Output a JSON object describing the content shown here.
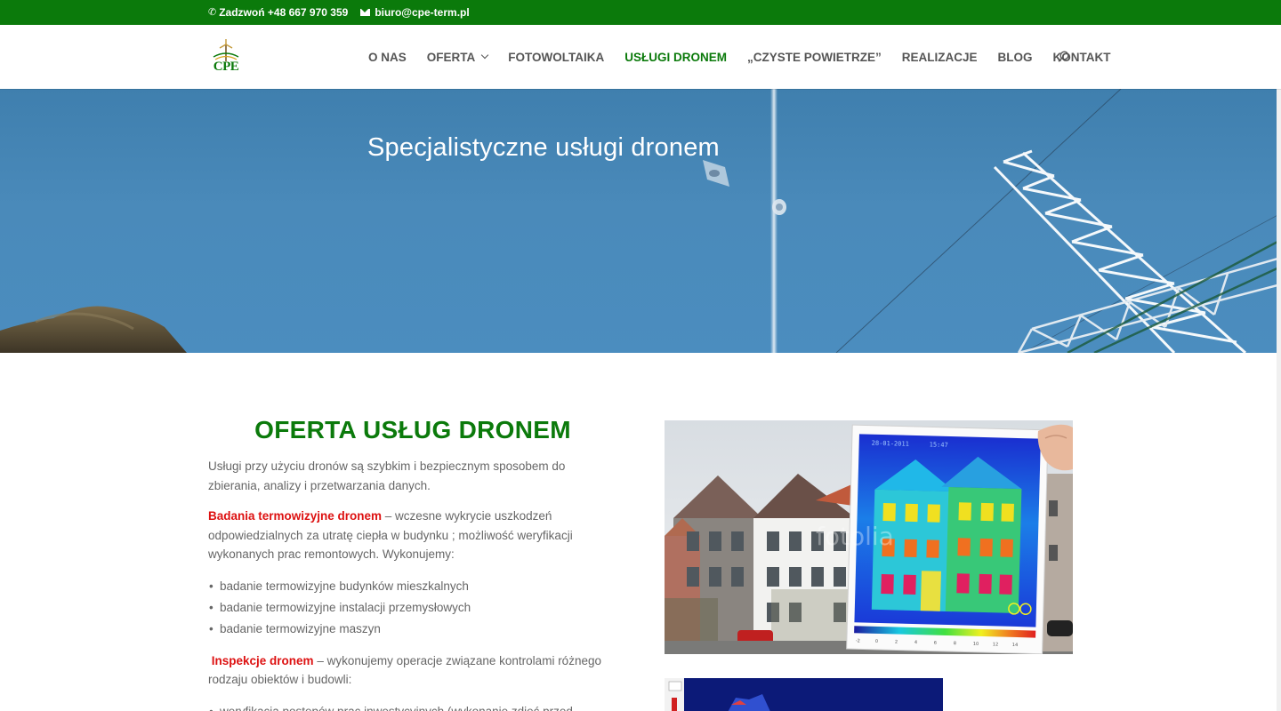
{
  "topbar": {
    "phone": "Zadzwoń +48 667 970 359",
    "email": "biuro@cpe-term.pl"
  },
  "header": {
    "logo_text": "CPE",
    "nav": [
      {
        "label": "O NAS",
        "active": false
      },
      {
        "label": "OFERTA",
        "active": false,
        "has_dropdown": true
      },
      {
        "label": "FOTOWOLTAIKA",
        "active": false
      },
      {
        "label": "USŁUGI DRONEM",
        "active": true
      },
      {
        "label": "„CZYSTE POWIETRZE”",
        "active": false
      },
      {
        "label": "REALIZACJE",
        "active": false
      },
      {
        "label": "BLOG",
        "active": false
      },
      {
        "label": "KONTAKT",
        "active": false
      }
    ],
    "search_icon": "search-icon"
  },
  "hero": {
    "title": "Specjalistyczne usługi dronem"
  },
  "content": {
    "title": "OFERTA USŁUG DRONEM",
    "intro": " Usługi przy użyciu dronów są szybkim i bezpiecznym sposobem do zbierania, analizy i przetwarzania danych.",
    "thermo_label": "Badania termowizyjne dronem",
    "thermo_text": " – wczesne wykrycie uszkodzeń odpowiedzialnych za utratę ciepła w budynku ; możliwość weryfikacji wykonanych prac remontowych. Wykonujemy:",
    "thermo_list": [
      "badanie termowizyjne budynków mieszkalnych",
      "badanie termowizyjne instalacji przemysłowych",
      "badanie termowizyjne maszyn"
    ],
    "inspect_label": "Inspekcje dronem",
    "inspect_text": " – wykonujemy operacje związane kontrolami różnego rodzaju obiektów i budowli:",
    "inspect_list": [
      "weryfikacja postępów prac inwestycyjnych (wykonanie zdjęć przed"
    ]
  },
  "image_main": {
    "date": "28-01-2011",
    "time": "15:47",
    "watermark": "fotolia"
  },
  "colors": {
    "brand_green": "#0b7a0b",
    "accent_red": "#dd1111",
    "text_gray": "#666666"
  }
}
